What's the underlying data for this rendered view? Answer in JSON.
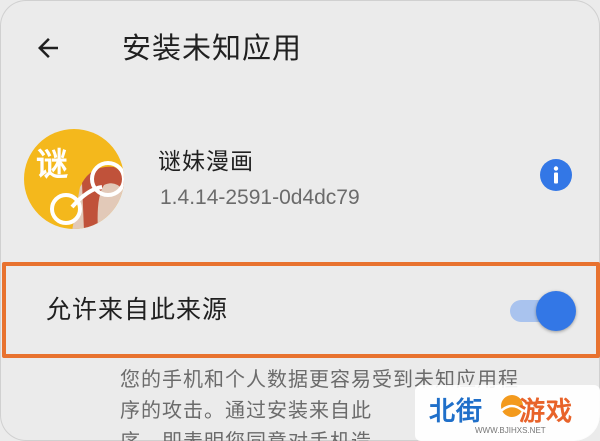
{
  "header": {
    "back_icon": "arrow-left-icon",
    "title": "安装未知应用"
  },
  "app": {
    "icon_text": "谜",
    "name": "谜妹漫画",
    "version": "1.4.14-2591-0d4dc79",
    "info_icon": "info-icon"
  },
  "permission": {
    "label": "允许来自此来源",
    "enabled": true
  },
  "description": {
    "line1": "您的手机和个人数据更容易受到未知应用程",
    "line2": "序的攻击。通过安装来自此",
    "line3": "序，即表明您同意对手机造"
  },
  "watermark": {
    "text_part1": "北街",
    "text_part2": "游戏",
    "url": "WWW.BJIHXS.NET"
  },
  "colors": {
    "background": "#ebebeb",
    "accent": "#3377e6",
    "highlight": "#e8722f",
    "icon_yellow": "#f4b81c"
  }
}
